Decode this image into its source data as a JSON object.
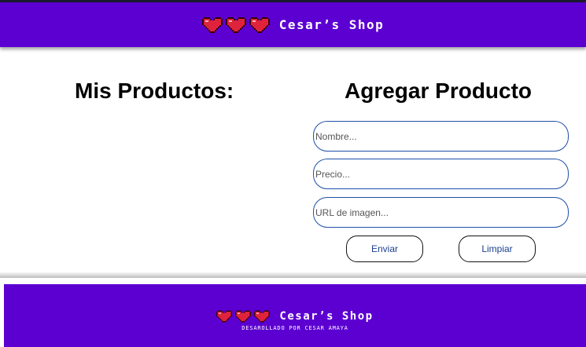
{
  "header": {
    "brand_name": "Cesar’s Shop",
    "icons": [
      "heart-icon",
      "heart-icon",
      "heart-icon"
    ]
  },
  "products": {
    "title": "Mis Productos:"
  },
  "form": {
    "title": "Agregar Producto",
    "fields": [
      {
        "placeholder": "Nombre...",
        "value": ""
      },
      {
        "placeholder": "Precio...",
        "value": ""
      },
      {
        "placeholder": "URL de imagen...",
        "value": ""
      }
    ],
    "send_label": "Enviar",
    "clear_label": "Limpiar"
  },
  "footer": {
    "brand_name": "Cesar’s Shop",
    "credit": "DESAROLLADO POR CESAR AMAYA"
  },
  "colors": {
    "primary": "#5c00d2",
    "heart": "#e0233c",
    "field_border": "#1f4fa8"
  }
}
